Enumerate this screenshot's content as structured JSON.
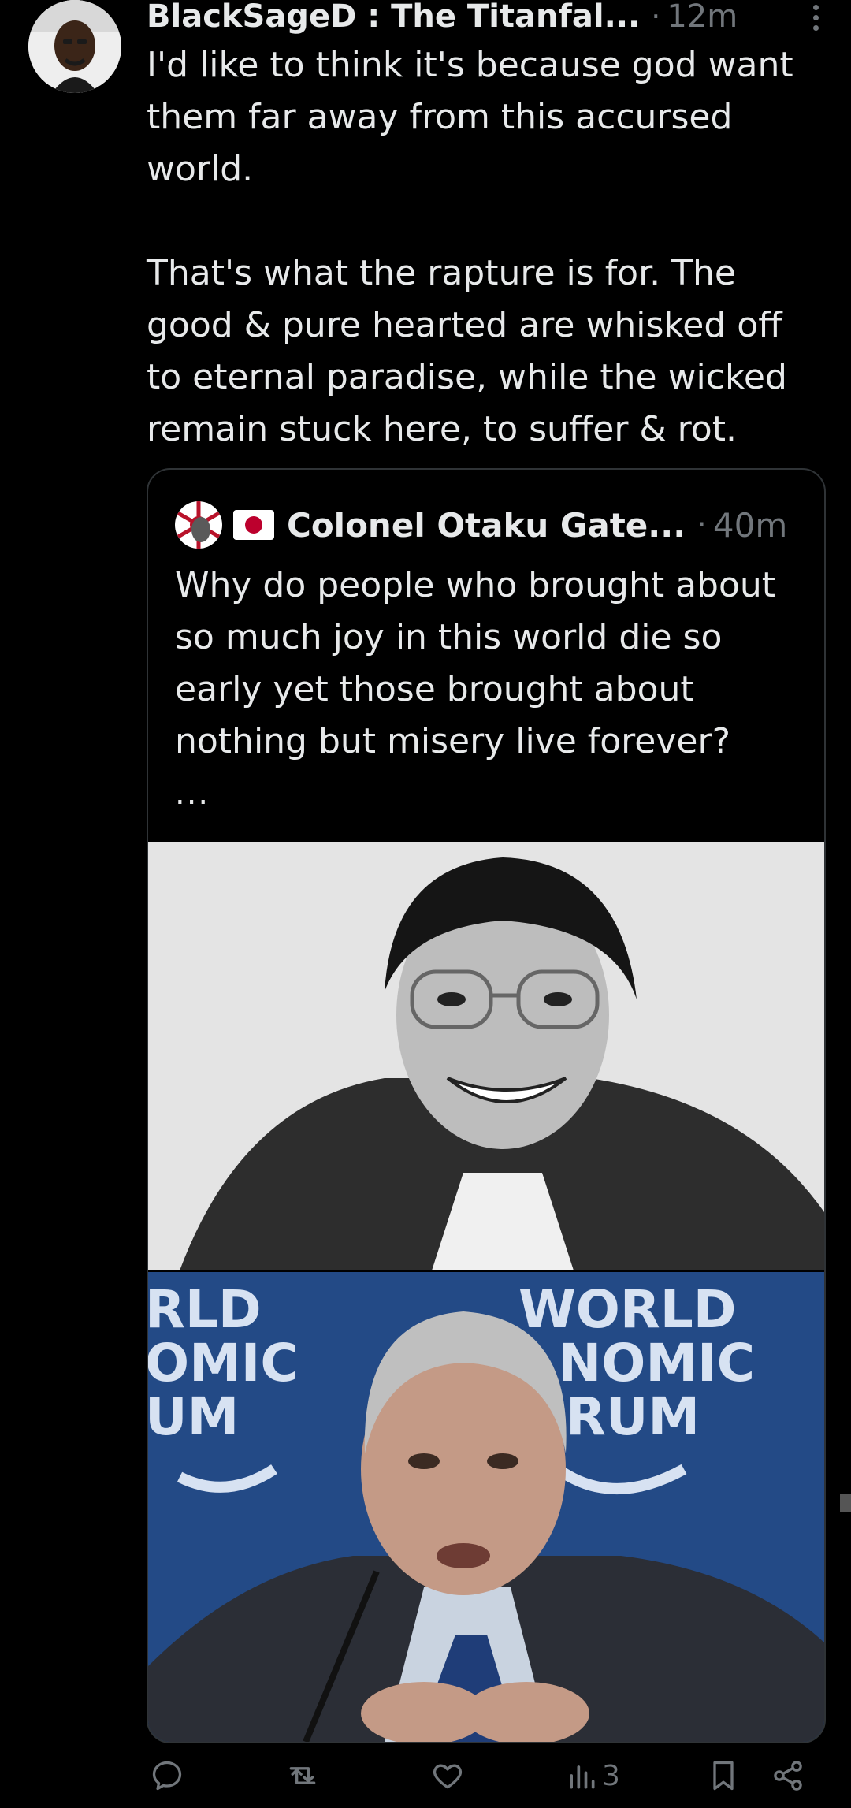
{
  "tweet": {
    "author": "BlackSageD : The Titanfal...",
    "separator": "·",
    "time": "12m",
    "paragraphs": [
      "I'd like to think it's because god want them far away from this accursed world.",
      "That's what the rapture is for. The good & pure hearted are whisked off to eternal paradise, while the wicked remain stuck here, to suffer & rot."
    ]
  },
  "quote": {
    "author": "Colonel Otaku Gate...",
    "separator": "·",
    "time": "40m",
    "text": "Why do people who brought about so much joy in this world die so early yet those brought about nothing but misery live forever?",
    "ellipsis": "...",
    "photo2_banner": [
      "RLD",
      "OMIC",
      "UM",
      "WORLD",
      "NOMIC",
      "RUM"
    ]
  },
  "actions": {
    "views_count": "3",
    "icons": [
      "reply-icon",
      "retweet-icon",
      "like-icon",
      "views-icon",
      "bookmark-icon",
      "share-icon"
    ]
  },
  "colors": {
    "background": "#000000",
    "text": "#e7e9ea",
    "muted": "#71767b",
    "border": "#2f3336",
    "flag_red": "#bc002d"
  }
}
